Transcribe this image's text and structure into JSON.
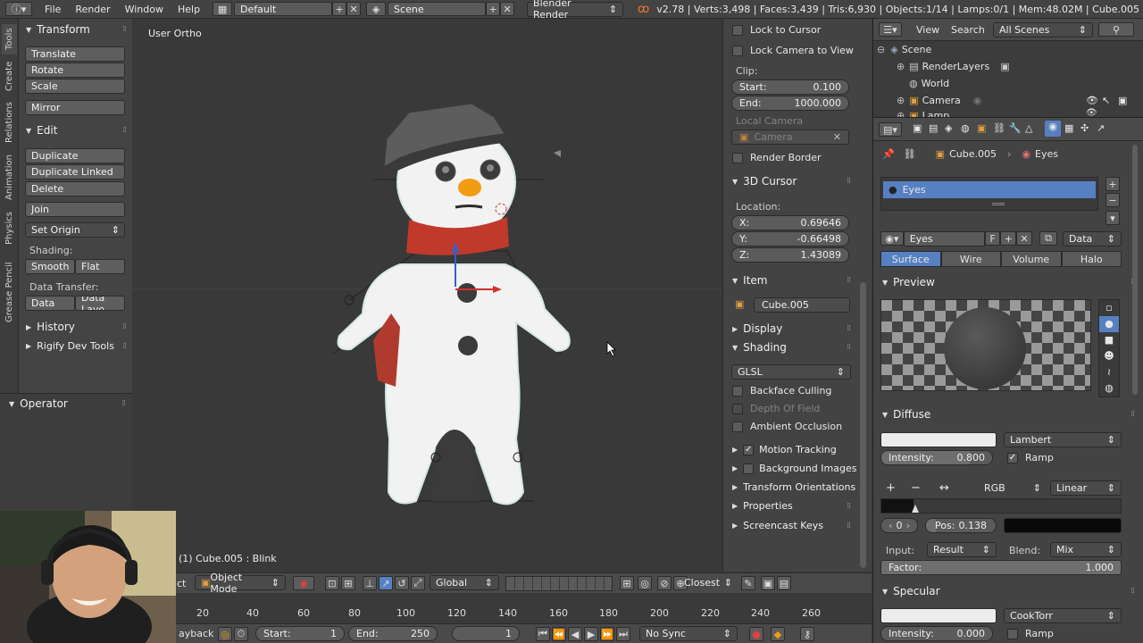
{
  "topbar": {
    "menus": [
      "File",
      "Render",
      "Window",
      "Help"
    ],
    "screen_layout": "Default",
    "scene": "Scene",
    "engine": "Blender Render",
    "stats": "v2.78 | Verts:3,498 | Faces:3,439 | Tris:6,930 | Objects:1/14 | Lamps:0/1 | Mem:48.02M | Cube.005"
  },
  "vtabs": [
    "Tools",
    "Create",
    "Relations",
    "Animation",
    "Physics",
    "Grease Pencil"
  ],
  "toolshelf": {
    "transform_title": "Transform",
    "translate": "Translate",
    "rotate": "Rotate",
    "scale": "Scale",
    "mirror": "Mirror",
    "edit_title": "Edit",
    "duplicate": "Duplicate",
    "duplicate_linked": "Duplicate Linked",
    "delete": "Delete",
    "join": "Join",
    "set_origin": "Set Origin",
    "shading_label": "Shading:",
    "smooth": "Smooth",
    "flat": "Flat",
    "data_transfer_label": "Data Transfer:",
    "data": "Data",
    "data_layout": "Data Layo",
    "history": "History",
    "rigify": "Rigify Dev Tools"
  },
  "operator": {
    "title": "Operator"
  },
  "viewport": {
    "view_name": "User Ortho",
    "object_info": "(1) Cube.005 : Blink"
  },
  "viewport_header": {
    "view_label": "ct",
    "mode": "Object Mode",
    "orientation": "Global",
    "snap": "Closest"
  },
  "timeline": {
    "ticks": [
      "20",
      "40",
      "60",
      "80",
      "100",
      "120",
      "140",
      "160",
      "180",
      "200",
      "220",
      "240",
      "260"
    ],
    "playback": "ayback",
    "start_label": "Start:",
    "start_value": "1",
    "end_label": "End:",
    "end_value": "250",
    "current_frame": "1",
    "sync": "No Sync"
  },
  "npanel": {
    "lock_to_cursor": "Lock to Cursor",
    "lock_camera": "Lock Camera to View",
    "clip_label": "Clip:",
    "clip_start_label": "Start:",
    "clip_start": "0.100",
    "clip_end_label": "End:",
    "clip_end": "1000.000",
    "local_camera_label": "Local Camera",
    "camera_field": "Camera",
    "render_border": "Render Border",
    "cursor_title": "3D Cursor",
    "location_label": "Location:",
    "x_label": "X:",
    "x_value": "0.69646",
    "y_label": "Y:",
    "y_value": "-0.66498",
    "z_label": "Z:",
    "z_value": "1.43089",
    "item_title": "Item",
    "item_name": "Cube.005",
    "display_title": "Display",
    "shading_title": "Shading",
    "shading_mode": "GLSL",
    "backface_culling": "Backface Culling",
    "depth_of_field": "Depth Of Field",
    "ambient_occlusion": "Ambient Occlusion",
    "motion_tracking": "Motion Tracking",
    "background_images": "Background Images",
    "transform_orientations": "Transform Orientations",
    "properties": "Properties",
    "screencast_keys": "Screencast Keys"
  },
  "outliner": {
    "view": "View",
    "search": "Search",
    "filter": "All Scenes",
    "items": [
      "Scene",
      "RenderLayers",
      "World",
      "Camera",
      "Lamp"
    ]
  },
  "properties": {
    "breadcrumb_object": "Cube.005",
    "breadcrumb_material": "Eyes",
    "material_slot": "Eyes",
    "material_name": "Eyes",
    "f_label": "F",
    "link": "Data",
    "tabs": [
      "Surface",
      "Wire",
      "Volume",
      "Halo"
    ],
    "preview_title": "Preview",
    "diffuse_title": "Diffuse",
    "diffuse_shader": "Lambert",
    "intensity_label": "Intensity:",
    "diffuse_intensity": "0.800",
    "ramp_label": "Ramp",
    "ramp_color_mode": "RGB",
    "ramp_interp": "Linear",
    "ramp_index": "0",
    "pos_label": "Pos:",
    "pos_value": "0.138",
    "input_label": "Input:",
    "input_value": "Result",
    "blend_label": "Blend:",
    "blend_value": "Mix",
    "factor_label": "Factor:",
    "factor_value": "1.000",
    "specular_title": "Specular",
    "specular_shader": "CookTorr",
    "specular_intensity": "0.000"
  },
  "colors": {
    "accent_blue": "#5680c2",
    "scarf_red": "#c0392b",
    "nose_orange": "#f39c12"
  }
}
